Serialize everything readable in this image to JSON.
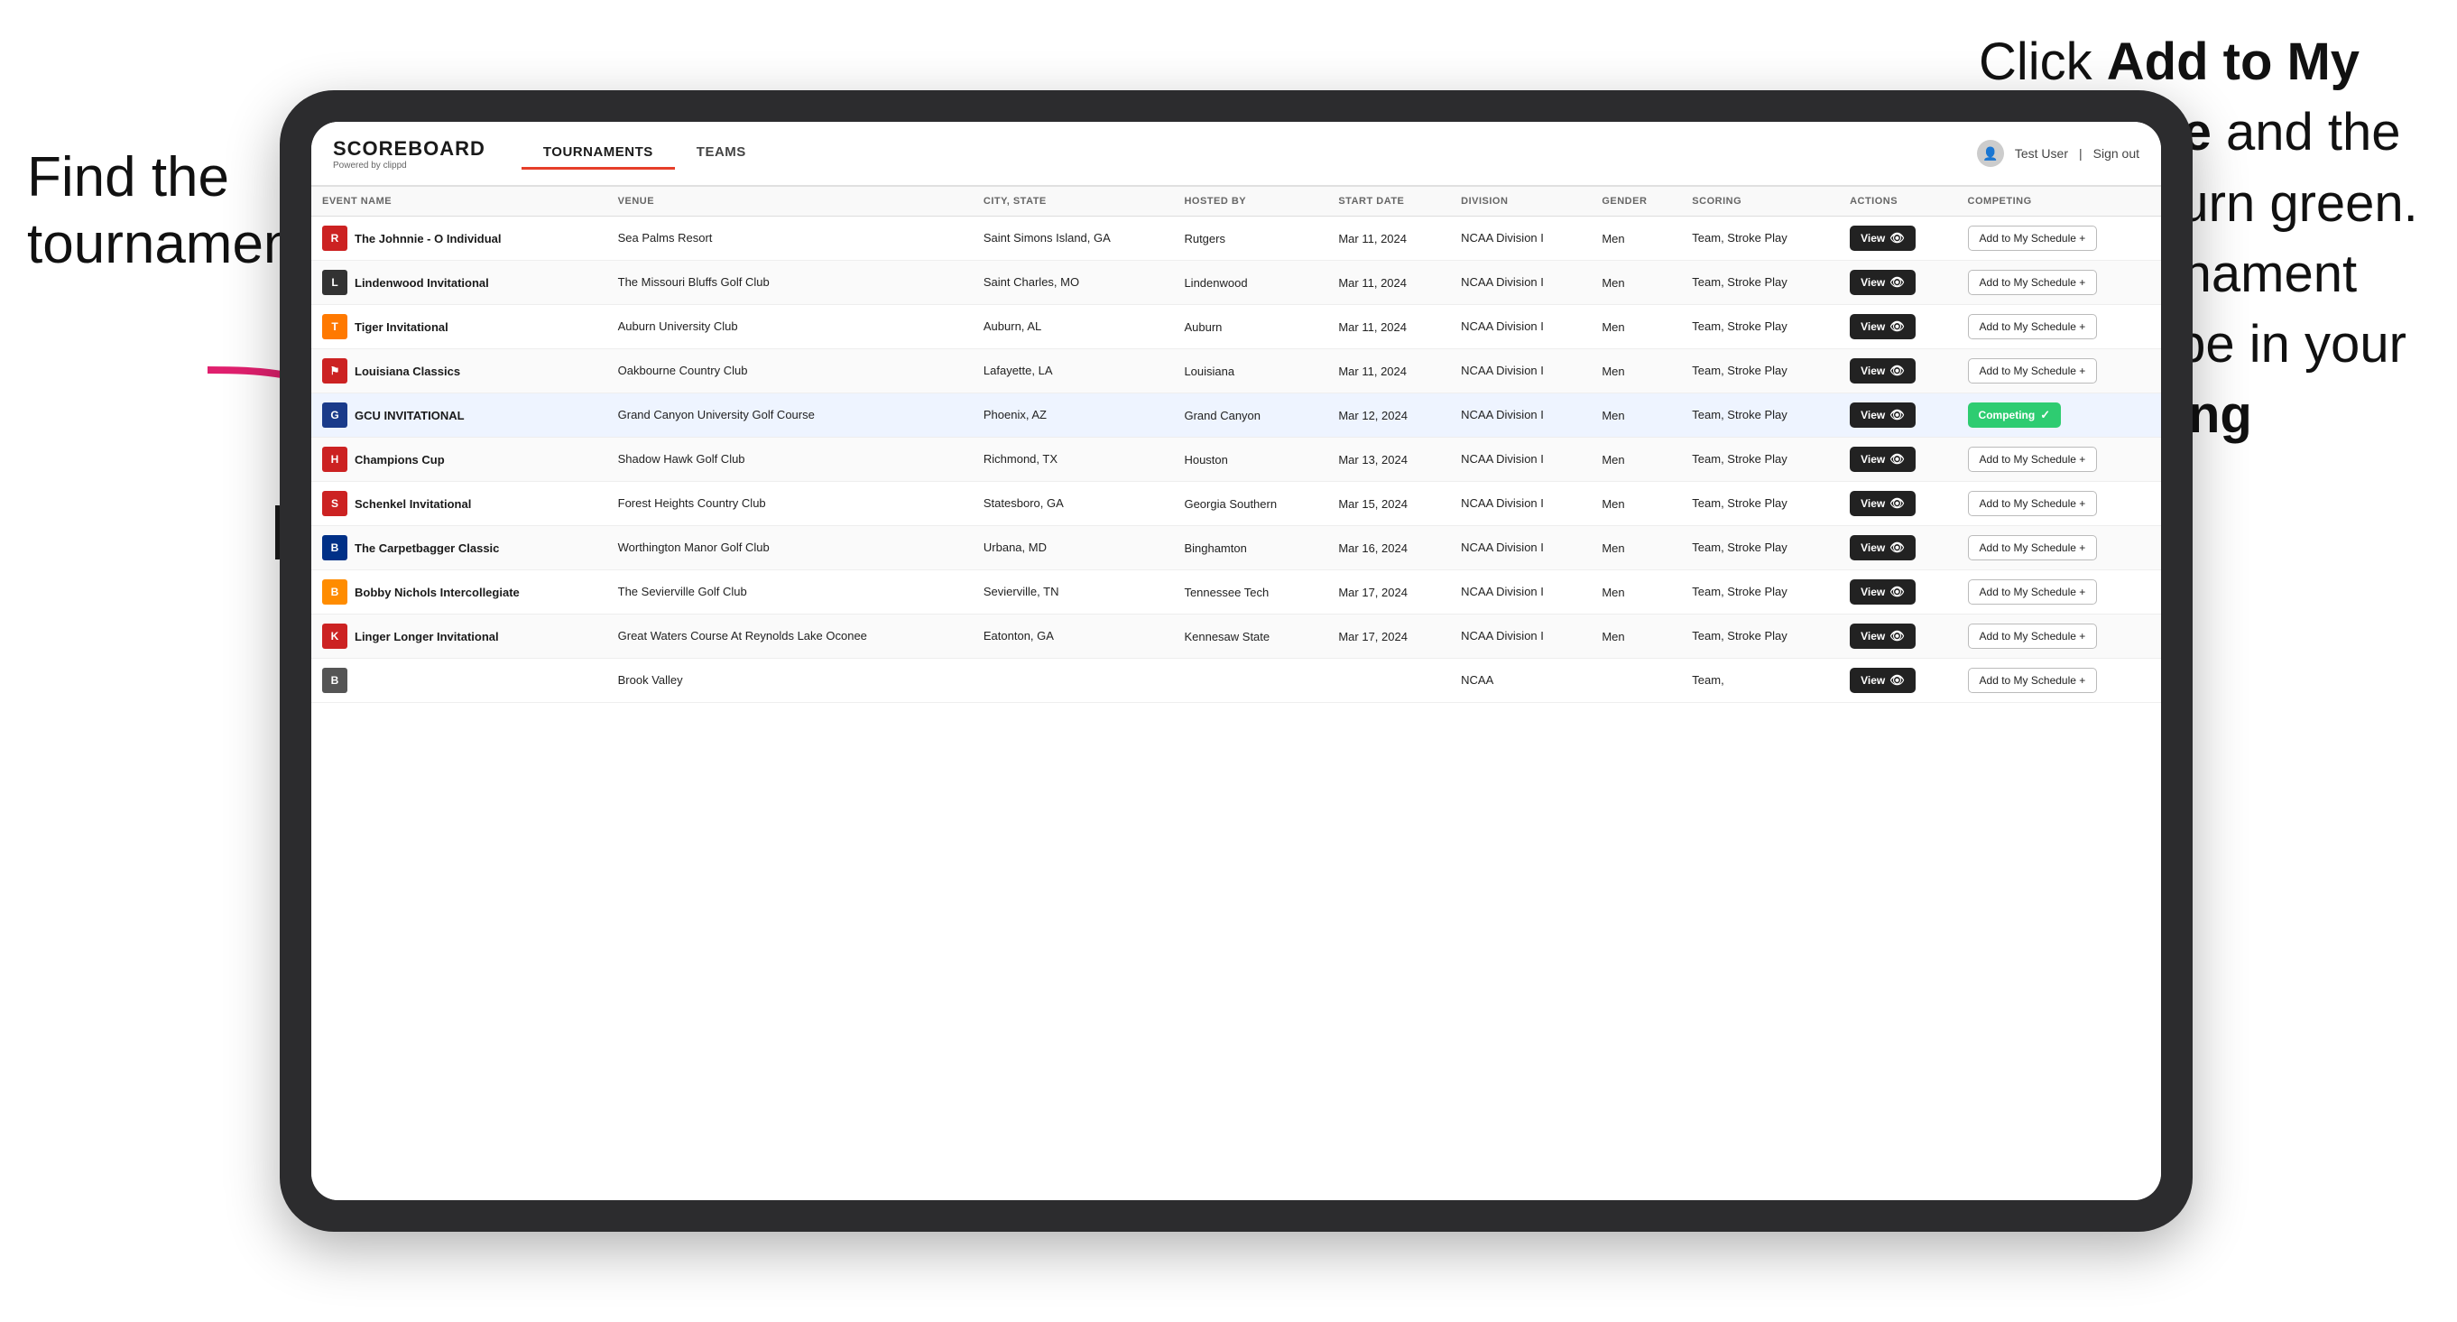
{
  "annotations": {
    "left_text_line1": "Find the",
    "left_text_line2": "tournament.",
    "right_text": "Click Add to My Schedule and the box will turn green. This tournament will now be in your Competing section.",
    "right_bold1": "Add to My Schedule",
    "right_bold2": "Competing"
  },
  "app": {
    "logo": "SCOREBOARD",
    "logo_sub": "Powered by clippd",
    "nav": [
      "TOURNAMENTS",
      "TEAMS"
    ],
    "active_nav": "TOURNAMENTS",
    "user_label": "Test User",
    "signout_label": "Sign out"
  },
  "table": {
    "columns": [
      "EVENT NAME",
      "VENUE",
      "CITY, STATE",
      "HOSTED BY",
      "START DATE",
      "DIVISION",
      "GENDER",
      "SCORING",
      "ACTIONS",
      "COMPETING"
    ],
    "rows": [
      {
        "logo_color": "#cc2222",
        "logo_letter": "R",
        "event_name": "The Johnnie - O Individual",
        "venue": "Sea Palms Resort",
        "city_state": "Saint Simons Island, GA",
        "hosted_by": "Rutgers",
        "start_date": "Mar 11, 2024",
        "division": "NCAA Division I",
        "gender": "Men",
        "scoring": "Team, Stroke Play",
        "status": "add",
        "highlighted": false
      },
      {
        "logo_color": "#333",
        "logo_letter": "L",
        "event_name": "Lindenwood Invitational",
        "venue": "The Missouri Bluffs Golf Club",
        "city_state": "Saint Charles, MO",
        "hosted_by": "Lindenwood",
        "start_date": "Mar 11, 2024",
        "division": "NCAA Division I",
        "gender": "Men",
        "scoring": "Team, Stroke Play",
        "status": "add",
        "highlighted": false
      },
      {
        "logo_color": "#FF7900",
        "logo_letter": "T",
        "event_name": "Tiger Invitational",
        "venue": "Auburn University Club",
        "city_state": "Auburn, AL",
        "hosted_by": "Auburn",
        "start_date": "Mar 11, 2024",
        "division": "NCAA Division I",
        "gender": "Men",
        "scoring": "Team, Stroke Play",
        "status": "add",
        "highlighted": false
      },
      {
        "logo_color": "#cc2222",
        "logo_letter": "⚑",
        "event_name": "Louisiana Classics",
        "venue": "Oakbourne Country Club",
        "city_state": "Lafayette, LA",
        "hosted_by": "Louisiana",
        "start_date": "Mar 11, 2024",
        "division": "NCAA Division I",
        "gender": "Men",
        "scoring": "Team, Stroke Play",
        "status": "add",
        "highlighted": false
      },
      {
        "logo_color": "#1a3b8a",
        "logo_letter": "G",
        "event_name": "GCU INVITATIONAL",
        "venue": "Grand Canyon University Golf Course",
        "city_state": "Phoenix, AZ",
        "hosted_by": "Grand Canyon",
        "start_date": "Mar 12, 2024",
        "division": "NCAA Division I",
        "gender": "Men",
        "scoring": "Team, Stroke Play",
        "status": "competing",
        "highlighted": true
      },
      {
        "logo_color": "#cc2222",
        "logo_letter": "H",
        "event_name": "Champions Cup",
        "venue": "Shadow Hawk Golf Club",
        "city_state": "Richmond, TX",
        "hosted_by": "Houston",
        "start_date": "Mar 13, 2024",
        "division": "NCAA Division I",
        "gender": "Men",
        "scoring": "Team, Stroke Play",
        "status": "add",
        "highlighted": false
      },
      {
        "logo_color": "#cc2222",
        "logo_letter": "S",
        "event_name": "Schenkel Invitational",
        "venue": "Forest Heights Country Club",
        "city_state": "Statesboro, GA",
        "hosted_by": "Georgia Southern",
        "start_date": "Mar 15, 2024",
        "division": "NCAA Division I",
        "gender": "Men",
        "scoring": "Team, Stroke Play",
        "status": "add",
        "highlighted": false
      },
      {
        "logo_color": "#003087",
        "logo_letter": "B",
        "event_name": "The Carpetbagger Classic",
        "venue": "Worthington Manor Golf Club",
        "city_state": "Urbana, MD",
        "hosted_by": "Binghamton",
        "start_date": "Mar 16, 2024",
        "division": "NCAA Division I",
        "gender": "Men",
        "scoring": "Team, Stroke Play",
        "status": "add",
        "highlighted": false
      },
      {
        "logo_color": "#FF8C00",
        "logo_letter": "B",
        "event_name": "Bobby Nichols Intercollegiate",
        "venue": "The Sevierville Golf Club",
        "city_state": "Sevierville, TN",
        "hosted_by": "Tennessee Tech",
        "start_date": "Mar 17, 2024",
        "division": "NCAA Division I",
        "gender": "Men",
        "scoring": "Team, Stroke Play",
        "status": "add",
        "highlighted": false
      },
      {
        "logo_color": "#cc2222",
        "logo_letter": "K",
        "event_name": "Linger Longer Invitational",
        "venue": "Great Waters Course At Reynolds Lake Oconee",
        "city_state": "Eatonton, GA",
        "hosted_by": "Kennesaw State",
        "start_date": "Mar 17, 2024",
        "division": "NCAA Division I",
        "gender": "Men",
        "scoring": "Team, Stroke Play",
        "status": "add",
        "highlighted": false
      },
      {
        "logo_color": "#555",
        "logo_letter": "B",
        "event_name": "",
        "venue": "Brook Valley",
        "city_state": "",
        "hosted_by": "",
        "start_date": "",
        "division": "NCAA",
        "gender": "",
        "scoring": "Team,",
        "status": "add",
        "highlighted": false
      }
    ],
    "view_label": "View",
    "add_label": "Add to My Schedule +",
    "competing_label": "Competing ✓"
  }
}
